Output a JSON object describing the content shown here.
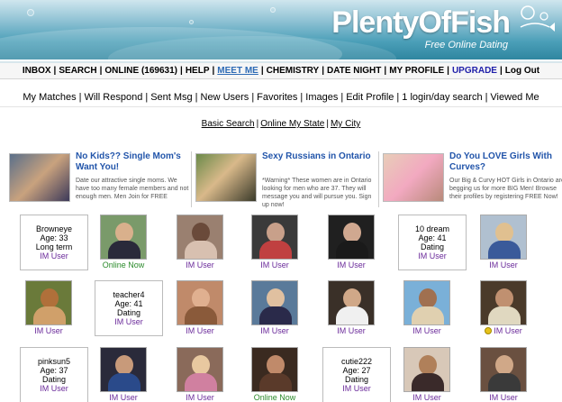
{
  "header": {
    "logo": "PlentyOfFish",
    "tagline": "Free Online Dating"
  },
  "mainnav": {
    "items": [
      "INBOX",
      "SEARCH",
      "ONLINE (169631)",
      "HELP",
      "MEET ME",
      "CHEMISTRY",
      "DATE NIGHT",
      "MY PROFILE",
      "UPGRADE",
      "Log Out"
    ]
  },
  "subnav": {
    "items": [
      "My Matches",
      "Will Respond",
      "Sent Msg",
      "New Users",
      "Favorites",
      "Images",
      "Edit Profile",
      "1 login/day search",
      "Viewed Me"
    ]
  },
  "search": {
    "items": [
      "Basic Search",
      "Online My State",
      "My City"
    ]
  },
  "ads": [
    {
      "title": "No Kids?? Single Mom's Want You!",
      "desc": "Date our attractive single moms. We have too many female members and not enough men. Men Join for FREE"
    },
    {
      "title": "Sexy Russians in Ontario",
      "desc": "*Warning* These women are in Ontario looking for men who are 37. They will message you and will pursue you. Sign up now!"
    },
    {
      "title": "Do You LOVE Girls With Curves?",
      "desc": "Our Big & Curvy HOT Girls in Ontario are begging us for more BIG Men! Browse their profiles by registering FREE Now!"
    }
  ],
  "grid": {
    "im_user": "IM User",
    "online_now": "Online Now",
    "profiles": [
      {
        "name": "Browneye",
        "age": "Age: 33",
        "status": "Long term",
        "im": "IM User"
      },
      {
        "name": "10 dream",
        "age": "Age: 41",
        "status": "Dating",
        "im": "IM User"
      },
      {
        "name": "teacher4",
        "age": "Age: 41",
        "status": "Dating",
        "im": "IM User"
      },
      {
        "name": "pinksun5",
        "age": "Age: 37",
        "status": "Dating",
        "im": "IM User"
      },
      {
        "name": "cutie222",
        "age": "Age: 27",
        "status": "Dating",
        "im": "IM User"
      }
    ]
  },
  "colors": {
    "link_purple": "#6a2a9a",
    "online_green": "#2a8a2a",
    "ad_title_blue": "#2255aa",
    "banner_teal": "#4b9fb8"
  }
}
